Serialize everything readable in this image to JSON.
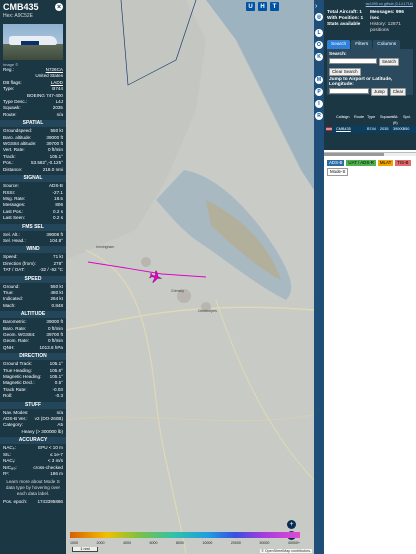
{
  "aircraft": {
    "callsign": "CMB435",
    "hex_line": "Hex: A9C52E",
    "image_label": "Image",
    "image_credit": "©"
  },
  "details": [
    {
      "k": "Reg.:",
      "v": "N726CA",
      "link": true
    },
    {
      "k": "",
      "v": "United States",
      "link": false
    },
    {
      "k": "DB flags:",
      "v": "LADD",
      "link": true
    },
    {
      "k": "Type:",
      "v": "B744",
      "link": false
    },
    {
      "k": "",
      "v": "BOEING 747-400",
      "link": false
    },
    {
      "k": "Type Desc.:",
      "v": "L4J",
      "link": false
    },
    {
      "k": "Squawk:",
      "v": "2035",
      "link": false
    },
    {
      "k": "Route:",
      "v": "n/a",
      "link": false
    }
  ],
  "sections": {
    "spatial": "SPATIAL",
    "signal": "SIGNAL",
    "fms": "FMS SEL",
    "wind": "WIND",
    "speed": "SPEED",
    "altitude": "ALTITUDE",
    "direction": "DIRECTION",
    "stuff": "STUFF",
    "accuracy": "ACCURACY"
  },
  "spatial": [
    {
      "k": "Groundspeed:",
      "v": "550 kt"
    },
    {
      "k": "Baro. altitude:",
      "v": "39000 ft"
    },
    {
      "k": "WGS84 altitude:",
      "v": "39700 ft"
    },
    {
      "k": "Vert. Rate:",
      "v": "0 ft/min"
    },
    {
      "k": "Track:",
      "v": "105.1°"
    },
    {
      "k": "Pos.:",
      "v": "53.582°,-0.125°"
    },
    {
      "k": "Distance:",
      "v": "218.0 nmi"
    }
  ],
  "signal": [
    {
      "k": "Source:",
      "v": "ADS-B"
    },
    {
      "k": "RSSI:",
      "v": "-27.1"
    },
    {
      "k": "Msg. Rate:",
      "v": "18.5"
    },
    {
      "k": "Messages:",
      "v": "806"
    },
    {
      "k": "Last Pos.:",
      "v": "0.2 s"
    },
    {
      "k": "Last Seen:",
      "v": "0.2 s"
    }
  ],
  "fms": [
    {
      "k": "Sel. Alt.:",
      "v": "39008 ft"
    },
    {
      "k": "Sel. Head.:",
      "v": "104.8°"
    }
  ],
  "wind": [
    {
      "k": "Speed:",
      "v": "71 kt"
    },
    {
      "k": "Direction (from):",
      "v": "278°"
    },
    {
      "k": "TAT / OAT:",
      "v": "-32 / -62 °C"
    }
  ],
  "speed": [
    {
      "k": "Ground:",
      "v": "550 kt"
    },
    {
      "k": "True:",
      "v": "480 kt"
    },
    {
      "k": "Indicated:",
      "v": "264 kt"
    },
    {
      "k": "Mach:",
      "v": "0.848"
    }
  ],
  "altitude": [
    {
      "k": "Barometric:",
      "v": "39000 ft"
    },
    {
      "k": "Baro. Rate:",
      "v": "0 ft/min"
    },
    {
      "k": "Geom. WGS84:",
      "v": "39700 ft"
    },
    {
      "k": "Geom. Rate:",
      "v": "0 ft/min"
    },
    {
      "k": "QNH:",
      "v": "1013.6 hPa"
    }
  ],
  "direction": [
    {
      "k": "Ground Track:",
      "v": "105.1°"
    },
    {
      "k": "True Heading:",
      "v": "105.6°"
    },
    {
      "k": "Magnetic Heading:",
      "v": "105.1°"
    },
    {
      "k": "Magnetic Decl.:",
      "v": "0.5°"
    },
    {
      "k": "Track Rate:",
      "v": "-0.03"
    },
    {
      "k": "Roll:",
      "v": "-0.3"
    }
  ],
  "stuff": [
    {
      "k": "Nav. Modes:",
      "v": "n/a"
    },
    {
      "k": "ADS-B Ver.:",
      "v": "v2 (DO-260B)"
    },
    {
      "k": "Category:",
      "v": "A5"
    },
    {
      "k": "",
      "v": "Heavy (> 300000 lb)"
    }
  ],
  "accuracy": [
    {
      "k": "NACₚ:",
      "v": "EPU < 10 m"
    },
    {
      "k": "SIL:",
      "v": "≤ 1e-7"
    },
    {
      "k": "NACᵥ:",
      "v": "< 3 m/s"
    },
    {
      "k": "NICₐᵣₒ:",
      "v": "cross-checked"
    },
    {
      "k": "Rᶜ:",
      "v": "186 m"
    }
  ],
  "learn_more": "Learn more about Mode S data type by hovering over each data label.",
  "pos_epoch": {
    "k": "Pos. epoch:",
    "v": "1743395866"
  },
  "map": {
    "top_buttons": [
      "U",
      "H",
      "T"
    ],
    "legend_labels": [
      "1000",
      "2000",
      "4000",
      "6000",
      "8000",
      "10000",
      "20000",
      "30000",
      "40000+"
    ],
    "scale": "1 nmi",
    "attribution": "© OpenStreetMap contributors.",
    "town_labels": [
      "Immingham",
      "Grimsby",
      "Cleethorpes"
    ]
  },
  "toolbar": {
    "arrow": "❮❯",
    "buttons": [
      "L",
      "O",
      "K",
      "M",
      "P",
      "I",
      "R"
    ]
  },
  "panel": {
    "github_link": "tar1090 on github (3.14.1716)",
    "total_aircraft": "Total Aircraft: 1",
    "with_position": "With Position: 1",
    "stats_available": "Stats available",
    "messages": "Messages: 996 /sec",
    "history": "History: 12871 positions",
    "tabs": [
      "Search",
      "Filters",
      "Columns"
    ],
    "search_label": "Search:",
    "search_btn": "Search",
    "clear_search_btn": "Clear Search",
    "jump_label": "Jump to Airport or Latitude, Longitude:",
    "jump_btn": "Jump",
    "clear_btn": "Clear",
    "columns": [
      "",
      "Callsign",
      "Route",
      "Type",
      "Squawk",
      "Alt. (ft)",
      "Spd."
    ],
    "row": {
      "callsign": "CMB435",
      "route": "",
      "type": "B744",
      "squawk": "2035",
      "alt": "39000",
      "spd": "550"
    },
    "filter_tags": [
      "ADS-B",
      "UAT / ADS-R",
      "MLAT",
      "TIS-B",
      "Mode-S"
    ]
  }
}
